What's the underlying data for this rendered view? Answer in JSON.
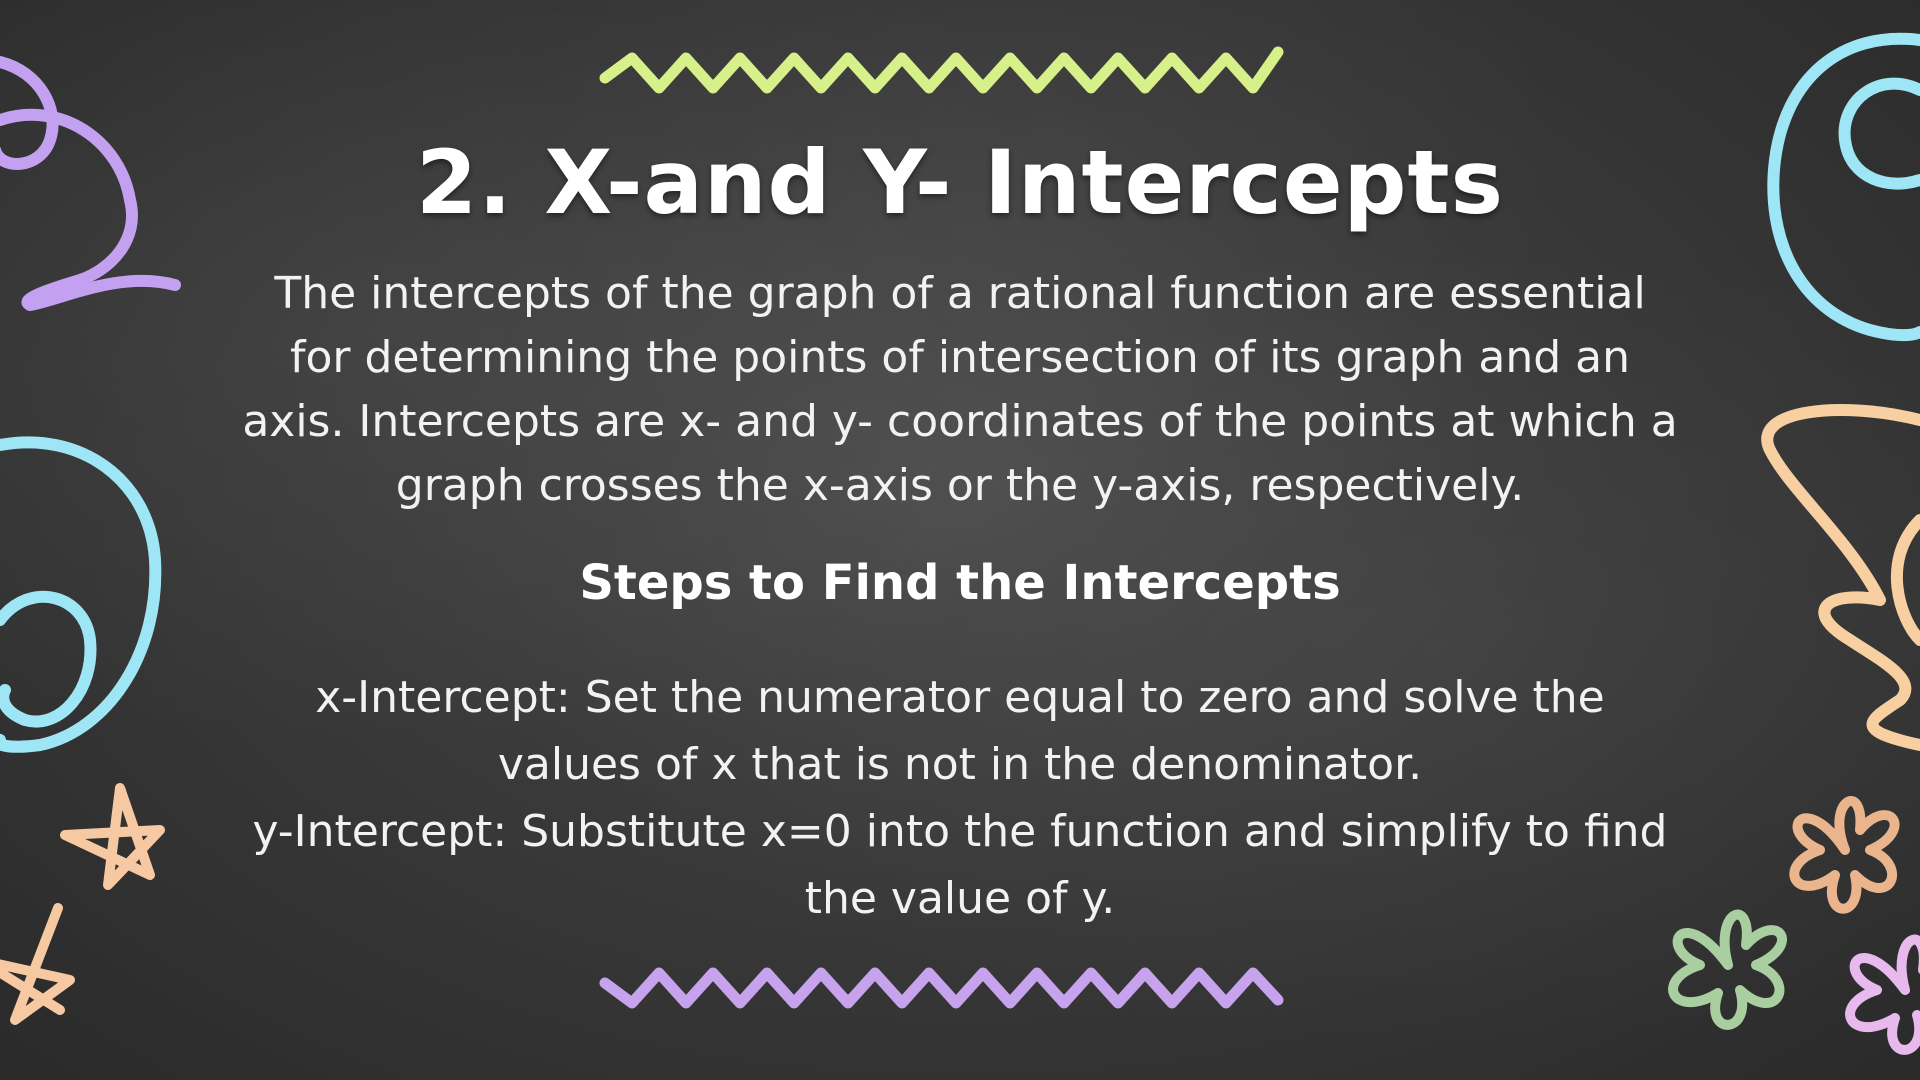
{
  "slide": {
    "title": "2. X-and Y- Intercepts",
    "intro": "The intercepts of the graph of a rational function are essential for determining the points of intersection of its graph and an axis. Intercepts are x- and y- coordinates of the points at which a graph crosses the x-axis or the y-axis, respectively.",
    "steps_heading": "Steps to Find the Intercepts",
    "steps": [
      "x-Intercept: Set the numerator equal to zero and solve the values of x that is not in the denominator.",
      "y-Intercept: Substitute x=0 into the function and simplify to find the value of y."
    ]
  },
  "colors": {
    "background": "#3a3a3a",
    "text": "#ffffff",
    "zigzag_top": "#d8f08a",
    "zigzag_bottom": "#c7a3ee",
    "swirl_purple": "#c3a0f0",
    "swirl_cyan": "#9ee6f5",
    "swirl_peach": "#f7cfa0",
    "star_peach": "#f7c9a2",
    "flower_orange": "#eab58c",
    "flower_green": "#a9cfa0",
    "flower_pink": "#e7b9ec"
  },
  "decorations": [
    "zigzag-top",
    "zigzag-bottom",
    "purple-swirl",
    "cyan-spiral-left",
    "cyan-spiral-right",
    "peach-scribble",
    "star",
    "flower"
  ]
}
